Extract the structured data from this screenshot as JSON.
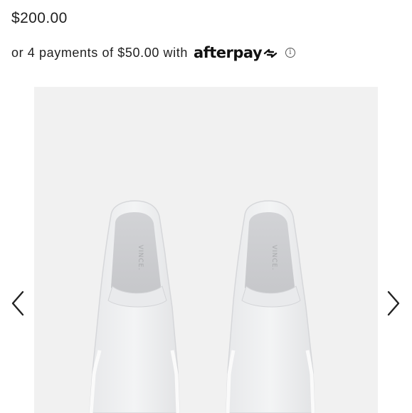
{
  "product": {
    "price": "$200.00",
    "installment_text": "or 4 payments of $50.00 with",
    "afterpay_brand": "afterpay",
    "info_glyph": "i"
  },
  "gallery": {
    "image_alt": "White knit slip-on sneakers",
    "shoe_brand_mark": "VINCE.",
    "prev_icon": "chevron-left-icon",
    "next_icon": "chevron-right-icon",
    "background_color": "#f1f1f1"
  }
}
